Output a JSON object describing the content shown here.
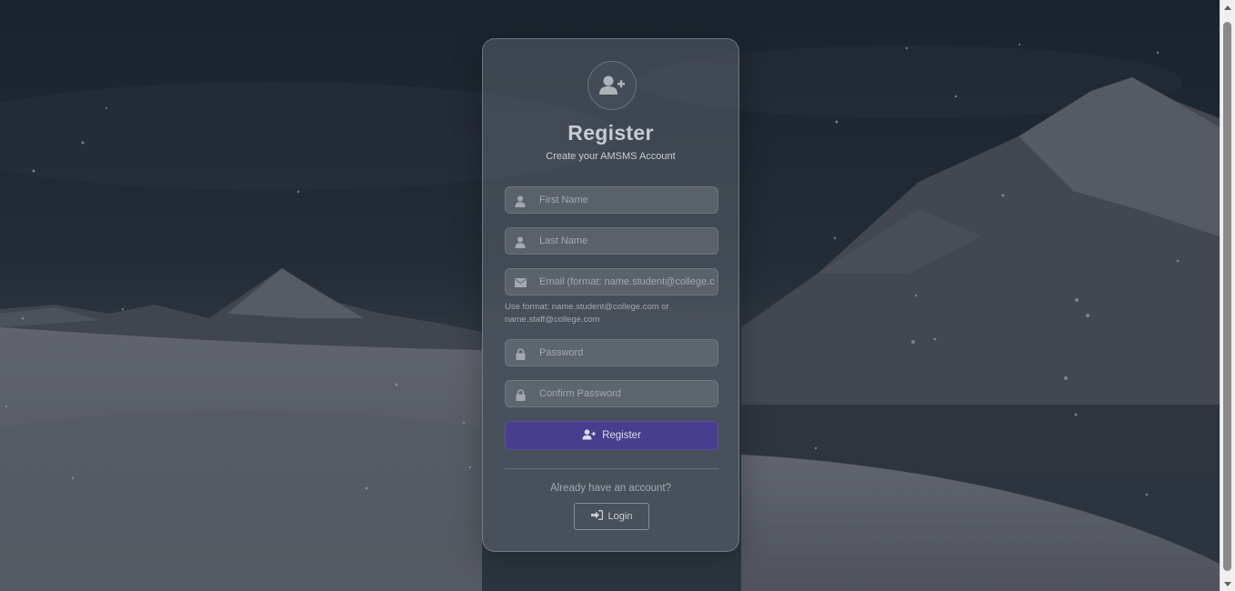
{
  "register_form": {
    "title": "Register",
    "subtitle": "Create your AMSMS Account",
    "fields": {
      "first_name": {
        "placeholder": "First Name",
        "icon": "user-icon"
      },
      "last_name": {
        "placeholder": "Last Name",
        "icon": "user-icon"
      },
      "email": {
        "placeholder": "Email (format: name.student@college.com)",
        "icon": "envelope-icon"
      },
      "password": {
        "placeholder": "Password",
        "icon": "lock-icon"
      },
      "confirm_password": {
        "placeholder": "Confirm Password",
        "icon": "lock-icon"
      }
    },
    "email_hint": "Use format: name.student@college.com or name.staff@college.com",
    "register_button_label": "Register",
    "register_button_icon": "user-plus-icon",
    "already_text": "Already have an account?",
    "login_button_label": "Login",
    "login_button_icon": "sign-in-icon"
  },
  "colors": {
    "accent": "#473f8e",
    "text": "#c8ccd2"
  }
}
